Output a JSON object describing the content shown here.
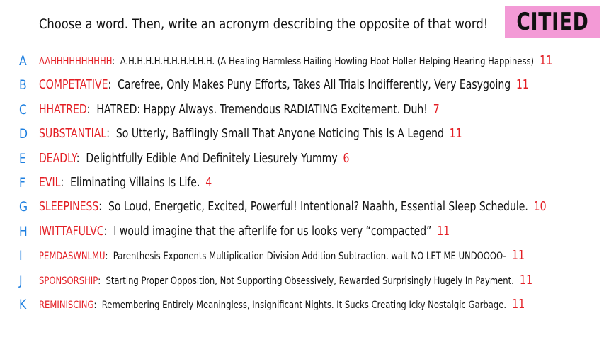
{
  "header": {
    "prompt": "Choose a word. Then, write an acronym describing the opposite of that word!",
    "logo_text": "CITIED"
  },
  "colors": {
    "letter": "#1d7fe0",
    "word": "#e31e24",
    "score": "#e31e24",
    "logo_bg": "#f39ad6"
  },
  "entries": [
    {
      "letter": "A",
      "word": "AAHHHHHHHHHH",
      "acronym": "A.H.H.H.H.H.H.H.H.H.H. (A Healing Harmless Hailing Howling Hoot Holler Helping Hearing Happiness)",
      "score": "11"
    },
    {
      "letter": "B",
      "word": "COMPETATIVE",
      "acronym": "Carefree, Only Makes Puny Efforts, Takes All Trials Indifferently, Very Easygoing",
      "score": "11"
    },
    {
      "letter": "C",
      "word": "HHATRED",
      "acronym": "HATRED: Happy Always. Tremendous RADIATING Excitement. Duh!",
      "score": "7"
    },
    {
      "letter": "D",
      "word": "SUBSTANTIAL",
      "acronym": "So Utterly, Bafflingly Small That Anyone Noticing This Is A Legend",
      "score": "11"
    },
    {
      "letter": "E",
      "word": "DEADLY",
      "acronym": "Delightfully Edible And Definitely Liesurely Yummy",
      "score": "6"
    },
    {
      "letter": "F",
      "word": "EVIL",
      "acronym": "Eliminating Villains Is Life.",
      "score": "4"
    },
    {
      "letter": "G",
      "word": "SLEEPINESS",
      "acronym": "So Loud, Energetic, Excited, Powerful! Intentional? Naahh, Essential Sleep Schedule.",
      "score": "10"
    },
    {
      "letter": "H",
      "word": "IWITTAFULVC",
      "acronym": "I would imagine that the afterlife for us looks very “compacted”",
      "score": "11"
    },
    {
      "letter": "I",
      "word": "PEMDASWNLMU",
      "acronym": "Parenthesis Exponents Multiplication Division Addition Subtraction. wait NO LET ME UNDOOOO-",
      "score": "11"
    },
    {
      "letter": "J",
      "word": "SPONSORSHIP",
      "acronym": "Starting Proper Opposition, Not Supporting Obsessively, Rewarded Surprisingly Hugely In Payment.",
      "score": "11"
    },
    {
      "letter": "K",
      "word": "REMINISCING",
      "acronym": "Remembering Entirely Meaningless, Insignificant Nights. It Sucks Creating Icky Nostalgic Garbage.",
      "score": "11"
    }
  ]
}
